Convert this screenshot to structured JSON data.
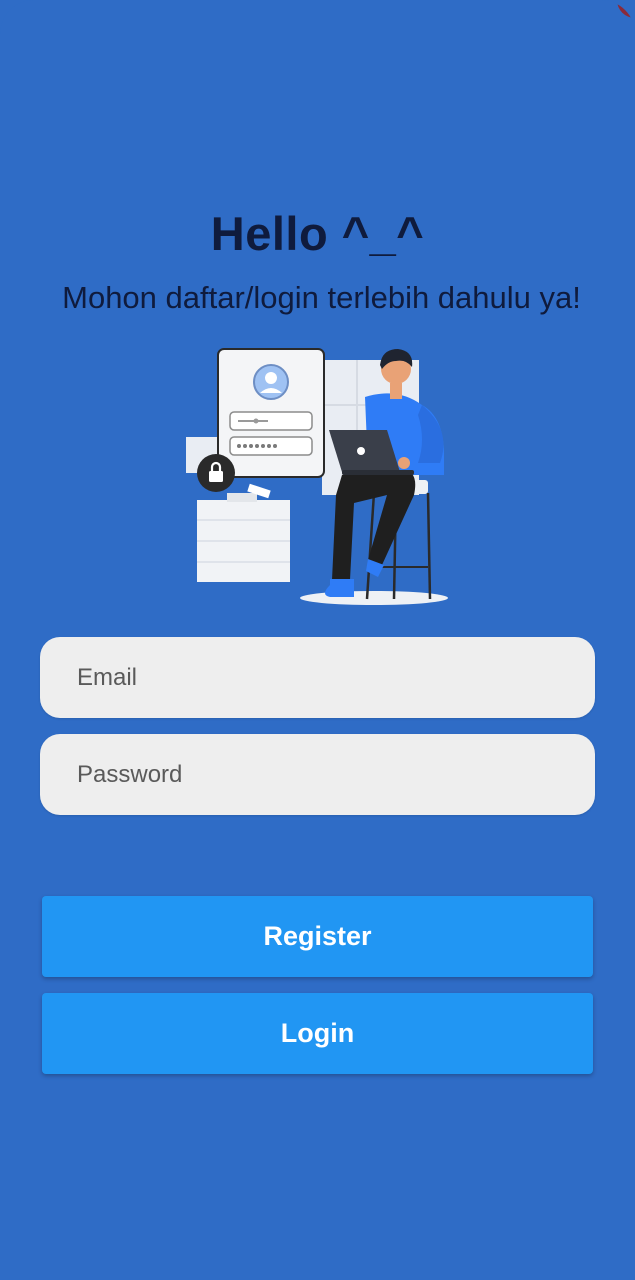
{
  "header": {
    "title": "Hello ^_^",
    "subtitle": "Mohon daftar/login terlebih dahulu ya!"
  },
  "illustration": {
    "icon": "login-illustration",
    "colors": {
      "card": "#f3f4f6",
      "accent_blue": "#2f7cf6",
      "dark": "#2a2a2a"
    }
  },
  "form": {
    "email_placeholder": "Email",
    "email_value": "",
    "password_placeholder": "Password",
    "password_value": ""
  },
  "actions": {
    "register_label": "Register",
    "login_label": "Login"
  },
  "colors": {
    "background": "#2f6cc6",
    "button": "#2196f3",
    "field": "#eeeeee",
    "title_text": "#0f1b3d"
  }
}
